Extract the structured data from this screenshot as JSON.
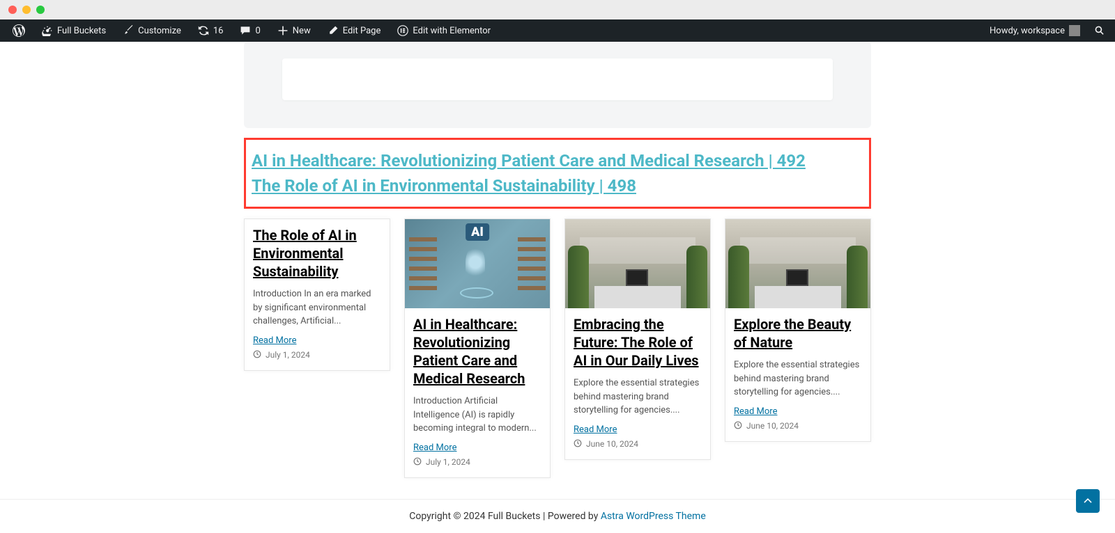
{
  "adminBar": {
    "siteName": "Full Buckets",
    "customize": "Customize",
    "updates": "16",
    "comments": "0",
    "new": "New",
    "editPage": "Edit Page",
    "editElementor": "Edit with Elementor",
    "greeting": "Howdy, workspace"
  },
  "highlightLinks": [
    "AI in Healthcare: Revolutionizing Patient Care and Medical Research | 492",
    "The Role of AI in Environmental Sustainability | 498"
  ],
  "cards": [
    {
      "title": "The Role of AI in Environmental Sustainability",
      "excerpt": "Introduction In an era marked by significant environmental challenges, Artificial...",
      "readMore": "Read More",
      "date": "July 1, 2024",
      "hasImage": false
    },
    {
      "title": "AI in Healthcare: Revolutionizing Patient Care and Medical Research",
      "excerpt": "Introduction Artificial Intelligence (AI) is rapidly becoming integral to modern...",
      "readMore": "Read More",
      "date": "July 1, 2024",
      "hasImage": true,
      "imageType": "ai"
    },
    {
      "title": "Embracing the Future: The Role of AI in Our Daily Lives",
      "excerpt": "Explore the essential strategies behind mastering brand storytelling for agencies....",
      "readMore": "Read More",
      "date": "June 10, 2024",
      "hasImage": true,
      "imageType": "office"
    },
    {
      "title": "Explore the Beauty of Nature",
      "excerpt": "Explore the essential strategies behind mastering brand storytelling for agencies....",
      "readMore": "Read More",
      "date": "June 10, 2024",
      "hasImage": true,
      "imageType": "office"
    }
  ],
  "footer": {
    "copyright": "Copyright © 2024 Full Buckets | Powered by ",
    "themeLink": "Astra WordPress Theme"
  }
}
